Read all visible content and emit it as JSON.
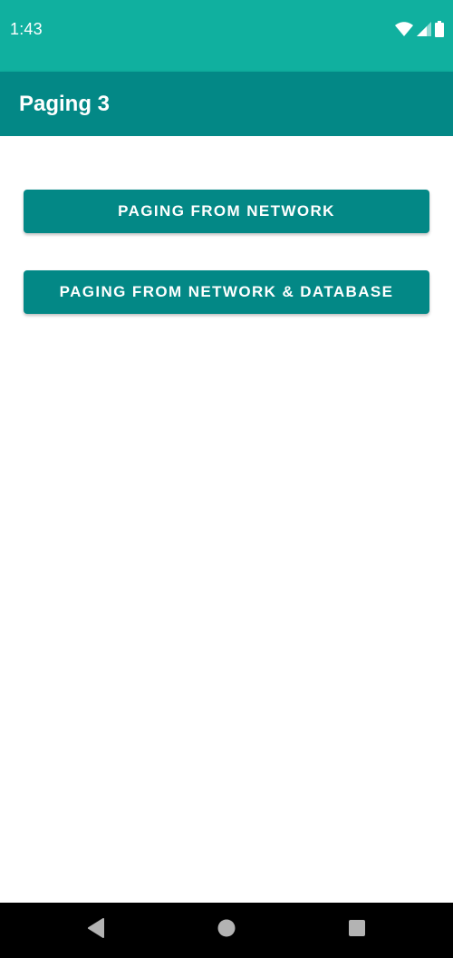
{
  "status_bar": {
    "time": "1:43",
    "icons": [
      "wifi-icon",
      "cell-signal-icon",
      "battery-icon"
    ],
    "background_color": "#10b09f"
  },
  "app_bar": {
    "title": "Paging 3",
    "background_color": "#038886"
  },
  "buttons": [
    {
      "label": "PAGING FROM NETWORK"
    },
    {
      "label": "PAGING FROM NETWORK & DATABASE"
    }
  ],
  "navigation_bar": {
    "icons": [
      "back-icon",
      "home-icon",
      "recents-icon"
    ]
  }
}
